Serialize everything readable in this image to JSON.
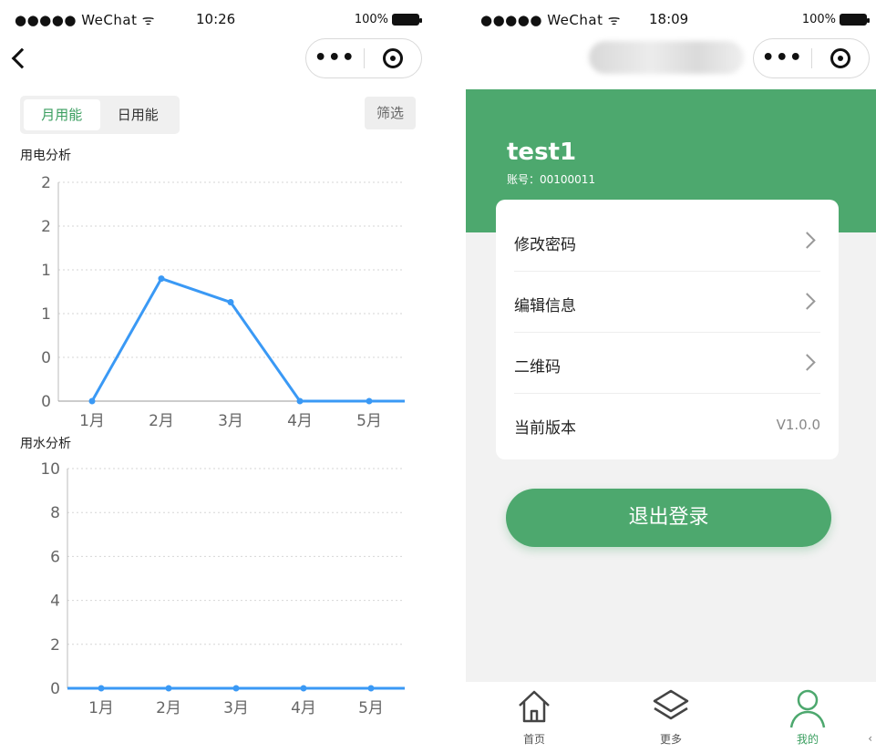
{
  "left": {
    "status": {
      "carrier": "●●●●● WeChat",
      "time": "10:26",
      "battery": "100%"
    },
    "tabs": [
      {
        "label": "月用能",
        "active": true
      },
      {
        "label": "日用能",
        "active": false
      }
    ],
    "filter_label": "筛选",
    "chart_data": [
      {
        "type": "line",
        "title": "用电分析",
        "categories": [
          "1月",
          "2月",
          "3月",
          "4月",
          "5月"
        ],
        "y_tick_labels": [
          "0",
          "0",
          "1",
          "1",
          "2",
          "2"
        ],
        "ylim": [
          0,
          2.5
        ],
        "values": [
          0,
          1.4,
          1.13,
          0,
          0
        ],
        "color": "#3a99f5",
        "grid": "dashed horizontal"
      },
      {
        "type": "line",
        "title": "用水分析",
        "categories": [
          "1月",
          "2月",
          "3月",
          "4月",
          "5月"
        ],
        "y_tick_labels": [
          "0",
          "2",
          "4",
          "6",
          "8",
          "10"
        ],
        "ylim": [
          0,
          10
        ],
        "values": [
          0,
          0,
          0,
          0,
          0
        ],
        "color": "#3a99f5",
        "grid": "dashed horizontal"
      }
    ]
  },
  "right": {
    "status": {
      "carrier": "●●●●● WeChat",
      "time": "18:09",
      "battery": "100%"
    },
    "user": {
      "name": "test1",
      "account": "账号：00100011"
    },
    "menu": [
      {
        "label": "修改密码",
        "value": ""
      },
      {
        "label": "编辑信息",
        "value": ""
      },
      {
        "label": "二维码",
        "value": ""
      },
      {
        "label": "当前版本",
        "value": "V1.0.0"
      }
    ],
    "logout_label": "退出登录",
    "tabbar": [
      {
        "label": "首页",
        "icon": "home-icon",
        "active": false
      },
      {
        "label": "更多",
        "icon": "layers-icon",
        "active": false
      },
      {
        "label": "我的",
        "icon": "user-icon",
        "active": true
      }
    ]
  },
  "colors": {
    "accent": "#4da86e",
    "line": "#3a99f5"
  }
}
